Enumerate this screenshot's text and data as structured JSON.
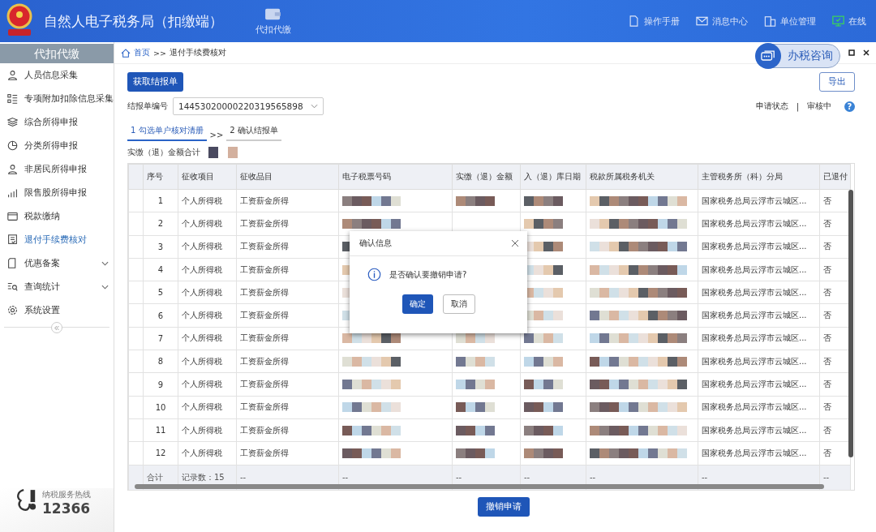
{
  "header": {
    "title": "自然人电子税务局（扣缴端）",
    "nav_tab": "代扣代缴",
    "links": [
      {
        "kind": "manual",
        "label": "操作手册"
      },
      {
        "kind": "message",
        "label": "消息中心"
      },
      {
        "kind": "unit",
        "label": "单位管理"
      },
      {
        "kind": "online",
        "label": "在线"
      }
    ]
  },
  "sidebar": {
    "title": "代扣代缴",
    "items": [
      {
        "label": "人员信息采集",
        "selected": false,
        "expandable": false
      },
      {
        "label": "专项附加扣除信息采集",
        "selected": false,
        "expandable": false
      },
      {
        "label": "综合所得申报",
        "selected": false,
        "expandable": false
      },
      {
        "label": "分类所得申报",
        "selected": false,
        "expandable": false
      },
      {
        "label": "非居民所得申报",
        "selected": false,
        "expandable": false
      },
      {
        "label": "限售股所得申报",
        "selected": false,
        "expandable": false
      },
      {
        "label": "税款缴纳",
        "selected": false,
        "expandable": false
      },
      {
        "label": "退付手续费核对",
        "selected": true,
        "expandable": false
      },
      {
        "label": "优惠备案",
        "selected": false,
        "expandable": true
      },
      {
        "label": "查询统计",
        "selected": false,
        "expandable": true
      },
      {
        "label": "系统设置",
        "selected": false,
        "expandable": false
      }
    ],
    "hotline": {
      "label": "纳税服务热线",
      "number": "12366"
    }
  },
  "breadcrumb": {
    "home": "首页",
    "separator": ">>",
    "current": "退付手续费核对"
  },
  "consult_button": "办税咨询",
  "get_button": "获取结报单",
  "export_button": "导出",
  "report_field": {
    "label": "结报单编号",
    "value": "14453020000220319565898"
  },
  "status": {
    "label": "申请状态",
    "separator": "|",
    "value": "审核中",
    "help": "?"
  },
  "steps": [
    {
      "label": "1 勾选单户核对清册",
      "selected": true
    },
    {
      "label": "2 确认结报单",
      "selected": false
    }
  ],
  "step_separator": ">>",
  "total_label": "实缴（退）金额合计",
  "table": {
    "columns": [
      "序号",
      "征收项目",
      "征收品目",
      "电子税票号码",
      "实缴（退）金额",
      "入（退）库日期",
      "税款所属税务机关",
      "主管税务所（科）分局",
      "已退付"
    ],
    "rows": [
      {
        "no": "1",
        "item": "个人所得税",
        "subitem": "工资薪金所得",
        "office": "国家税务总局云浮市云城区...",
        "refunded": "否"
      },
      {
        "no": "2",
        "item": "个人所得税",
        "subitem": "工资薪金所得",
        "office": "国家税务总局云浮市云城区...",
        "refunded": "否"
      },
      {
        "no": "3",
        "item": "个人所得税",
        "subitem": "工资薪金所得",
        "office": "国家税务总局云浮市云城区...",
        "refunded": "否"
      },
      {
        "no": "4",
        "item": "个人所得税",
        "subitem": "工资薪金所得",
        "office": "国家税务总局云浮市云城区...",
        "refunded": "否"
      },
      {
        "no": "5",
        "item": "个人所得税",
        "subitem": "工资薪金所得",
        "office": "国家税务总局云浮市云城区...",
        "refunded": "否"
      },
      {
        "no": "6",
        "item": "个人所得税",
        "subitem": "工资薪金所得",
        "office": "国家税务总局云浮市云城区...",
        "refunded": "否"
      },
      {
        "no": "7",
        "item": "个人所得税",
        "subitem": "工资薪金所得",
        "office": "国家税务总局云浮市云城区...",
        "refunded": "否"
      },
      {
        "no": "8",
        "item": "个人所得税",
        "subitem": "工资薪金所得",
        "office": "国家税务总局云浮市云城区...",
        "refunded": "否"
      },
      {
        "no": "9",
        "item": "个人所得税",
        "subitem": "工资薪金所得",
        "office": "国家税务总局云浮市云城区...",
        "refunded": "否"
      },
      {
        "no": "10",
        "item": "个人所得税",
        "subitem": "工资薪金所得",
        "office": "国家税务总局云浮市云城区...",
        "refunded": "否"
      },
      {
        "no": "11",
        "item": "个人所得税",
        "subitem": "工资薪金所得",
        "office": "国家税务总局云浮市云城区...",
        "refunded": "否"
      },
      {
        "no": "12",
        "item": "个人所得税",
        "subitem": "工资薪金所得",
        "office": "国家税务总局云浮市云城区...",
        "refunded": "否"
      }
    ],
    "footer": [
      "合计",
      "记录数：15",
      "--",
      "--",
      "--",
      "--",
      "--",
      "--",
      "--"
    ]
  },
  "dialog": {
    "title": "确认信息",
    "message": "是否确认要撤销申请?",
    "confirm": "确定",
    "cancel": "取消"
  },
  "revoke_button": "撤销申请"
}
